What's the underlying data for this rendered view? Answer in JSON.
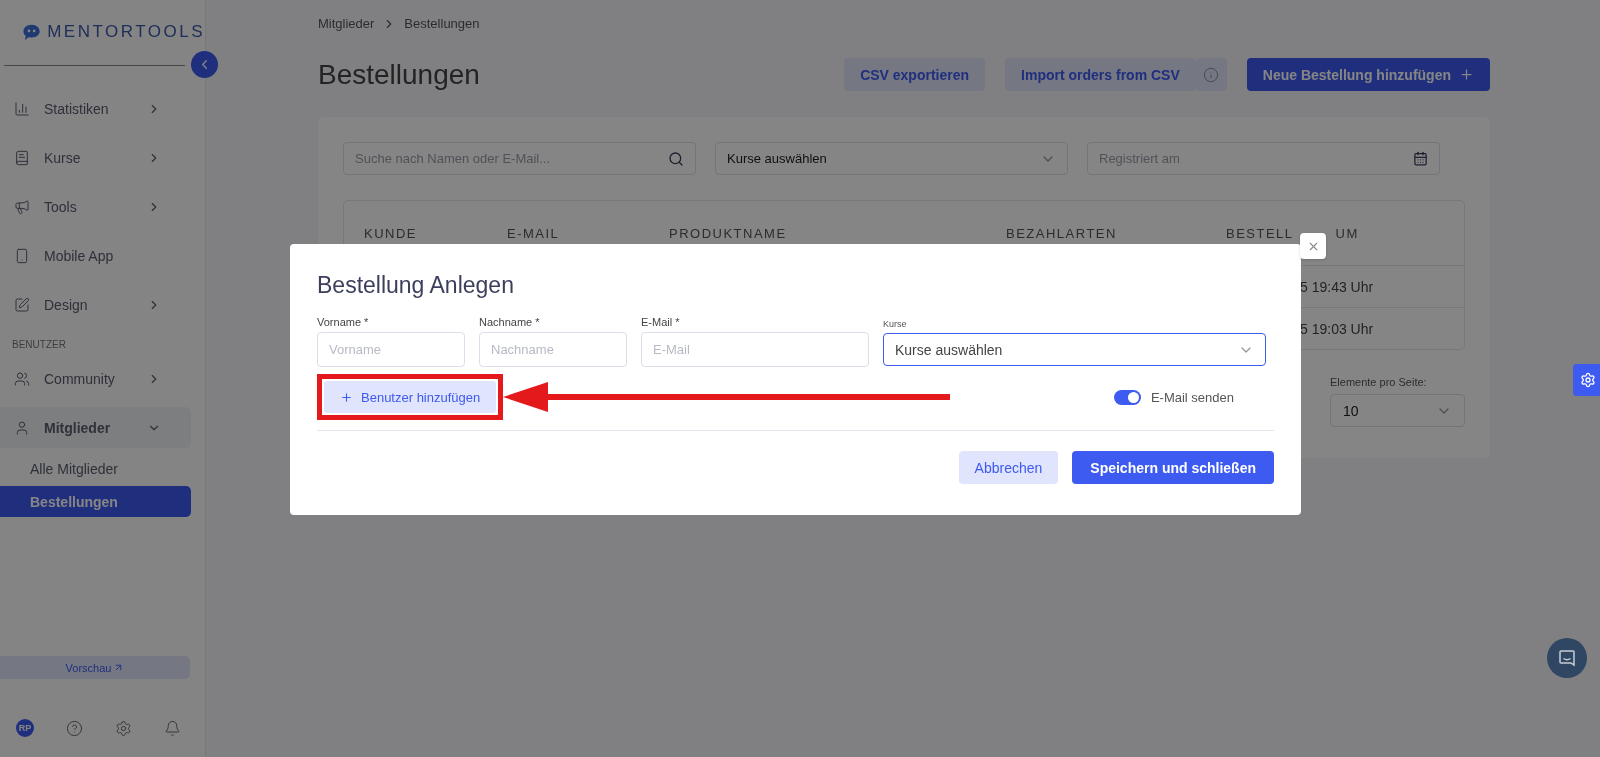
{
  "sidebar": {
    "logo": "MENTORTOOLS",
    "sections": [
      {
        "items": [
          {
            "label": "Statistiken",
            "kind": "group",
            "expanded": false
          },
          {
            "label": "Kurse",
            "kind": "group",
            "expanded": false
          },
          {
            "label": "Tools",
            "kind": "group",
            "expanded": false
          },
          {
            "label": "Mobile App",
            "kind": "link"
          },
          {
            "label": "Design",
            "kind": "group",
            "expanded": false
          }
        ]
      },
      {
        "title": "BENUTZER",
        "items": [
          {
            "label": "Community",
            "kind": "group",
            "expanded": false
          },
          {
            "label": "Mitglieder",
            "kind": "group",
            "expanded": true,
            "children": [
              {
                "label": "Alle Mitglieder",
                "selected": false
              },
              {
                "label": "Bestellungen",
                "selected": true
              }
            ]
          }
        ]
      }
    ],
    "preview_button": "Vorschau",
    "avatar": "RP"
  },
  "breadcrumb": [
    "Mitglieder",
    "Bestellungen"
  ],
  "page_title": "Bestellungen",
  "header_buttons": [
    {
      "label": "CSV exportieren",
      "kind": "secondary"
    },
    {
      "label": "Import orders from CSV",
      "kind": "secondary"
    },
    {
      "label": "Neue Bestellung hinzufügen",
      "kind": "primary"
    }
  ],
  "filters": {
    "search": {
      "placeholder": "Suche nach Namen oder E-Mail..."
    },
    "courses": {
      "value": "Kurse auswählen"
    },
    "date": {
      "placeholder": "Registriert am"
    }
  },
  "table": {
    "columns": [
      "KUNDE",
      "E-MAIL",
      "PRODUKTNAME",
      "BEZAHLARTEN",
      "BESTELL"
    ],
    "last_column_tail": "UM",
    "rows": [
      {
        "date": "5 19:43 Uhr"
      },
      {
        "date": "5 19:03 Uhr"
      }
    ]
  },
  "pagination": {
    "label": "Elemente pro Seite:",
    "value": "10"
  },
  "modal": {
    "title": "Bestellung Anlegen",
    "fields": [
      {
        "label": "Vorname *",
        "placeholder": "Vorname",
        "kind": "text"
      },
      {
        "label": "Nachname *",
        "placeholder": "Nachname",
        "kind": "text"
      },
      {
        "label": "E-Mail *",
        "placeholder": "E-Mail",
        "kind": "text"
      },
      {
        "label": "Kurse",
        "value": "Kurse auswählen",
        "kind": "select"
      }
    ],
    "add_user_button": "Benutzer hinzufügen",
    "send_email": {
      "label": "E-Mail senden",
      "on": true
    },
    "buttons": [
      {
        "label": "Abbrechen",
        "kind": "secondary"
      },
      {
        "label": "Speichern und schließen",
        "kind": "primary"
      }
    ]
  }
}
